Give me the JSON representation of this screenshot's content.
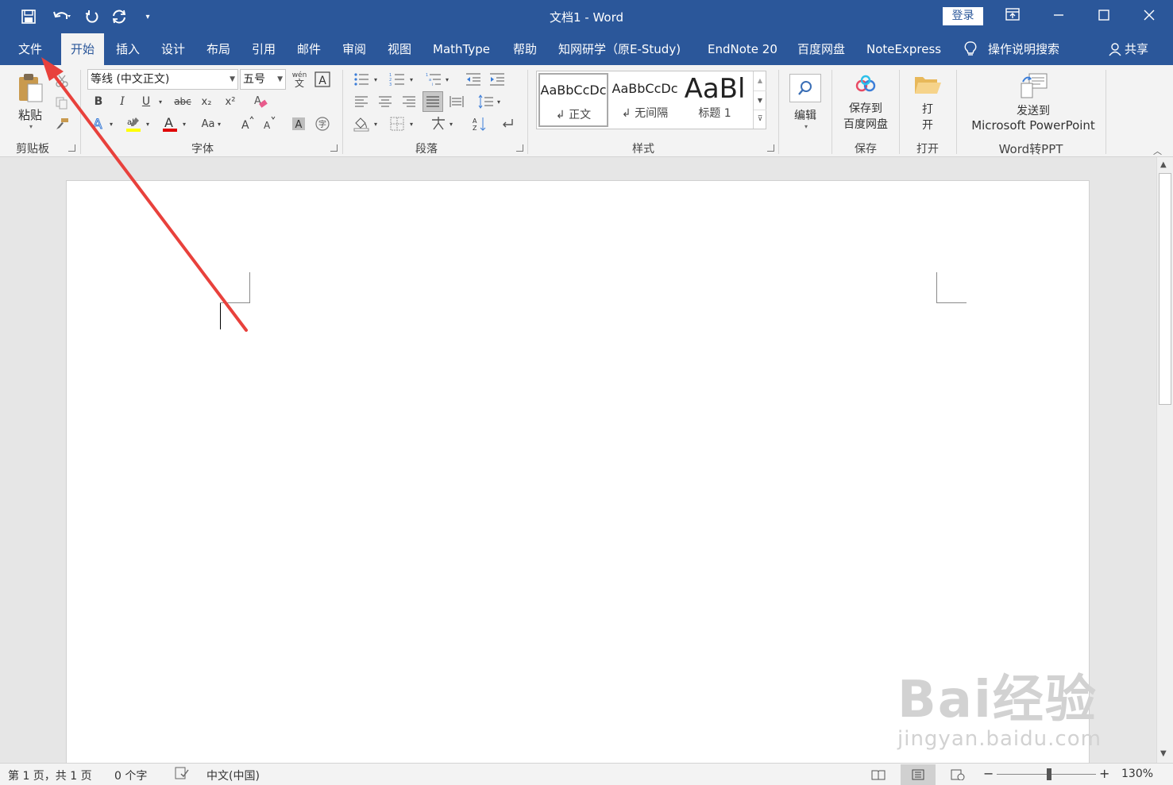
{
  "window": {
    "title": "文档1 - Word",
    "login": "登录"
  },
  "tabs": [
    "文件",
    "开始",
    "插入",
    "设计",
    "布局",
    "引用",
    "邮件",
    "审阅",
    "视图",
    "MathType",
    "帮助",
    "知网研学（原E-Study)",
    "EndNote 20",
    "百度网盘",
    "NoteExpress"
  ],
  "active_tab": "开始",
  "search_hint": "操作说明搜索",
  "share": "共享",
  "ribbon": {
    "clipboard": {
      "paste": "粘贴",
      "label": "剪贴板"
    },
    "font": {
      "name": "等线 (中文正文)",
      "size": "五号",
      "label": "字体",
      "bold": "B",
      "italic": "I",
      "underline": "U",
      "strike": "abc",
      "sub": "x₂",
      "sup": "x²",
      "wen": "wén",
      "case": "Aa"
    },
    "paragraph": {
      "label": "段落"
    },
    "styles": {
      "label": "样式",
      "items": [
        {
          "sample": "AaBbCcDc",
          "name": "正文"
        },
        {
          "sample": "AaBbCcDc",
          "name": "无间隔"
        },
        {
          "sample": "AaBl",
          "name": "标题 1"
        }
      ]
    },
    "edit": {
      "label": "编辑"
    },
    "save": {
      "btn": "保存到\n百度网盘",
      "btn_line1": "保存到",
      "btn_line2": "百度网盘",
      "label": "保存"
    },
    "open": {
      "btn_line1": "打",
      "btn_line2": "开",
      "label": "打开"
    },
    "ppt": {
      "btn_line1": "发送到",
      "btn_line2": "Microsoft PowerPoint",
      "label": "Word转PPT"
    }
  },
  "status": {
    "page": "第 1 页，共 1 页",
    "words": "0 个字",
    "lang": "中文(中国)",
    "zoom": "130%",
    "zoom_minus": "−",
    "zoom_plus": "+"
  },
  "watermark": {
    "line1": "Bai经验",
    "line2": "jingyan.baidu.com"
  },
  "colors": {
    "accent": "#2b579a",
    "arrow": "#e8413c"
  },
  "zoom_level": 130
}
